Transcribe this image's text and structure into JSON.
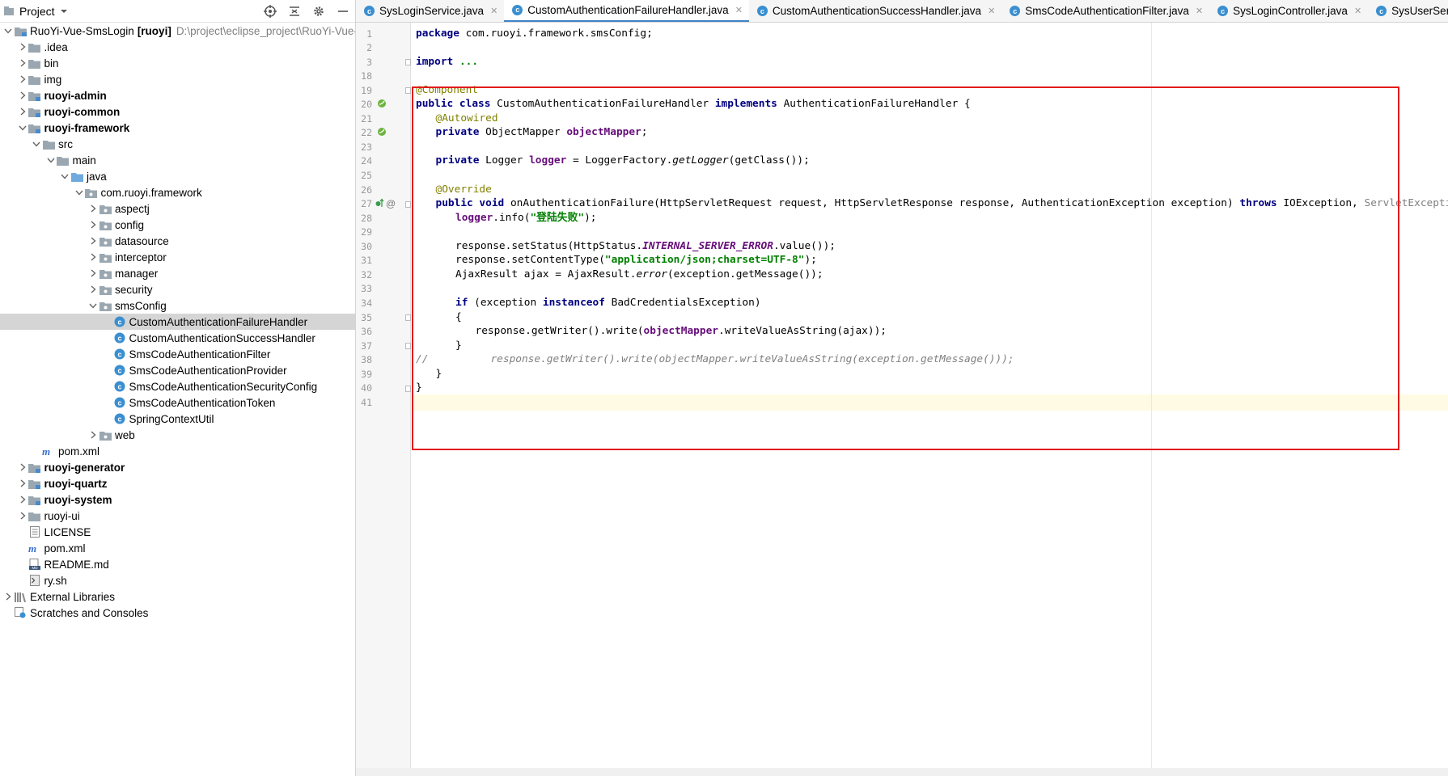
{
  "project_panel": {
    "title": "Project",
    "tree": [
      {
        "label": "RuoYi-Vue-SmsLogin",
        "suffix": "[ruoyi]",
        "path": "D:\\project\\eclipse_project\\RuoYi-Vue-Sm",
        "icon": "module-folder-icon",
        "expanded": true
      },
      {
        "label": ".idea",
        "icon": "folder-icon"
      },
      {
        "label": "bin",
        "icon": "folder-icon"
      },
      {
        "label": "img",
        "icon": "folder-icon"
      },
      {
        "label": "ruoyi-admin",
        "icon": "module-folder-icon"
      },
      {
        "label": "ruoyi-common",
        "icon": "module-folder-icon"
      },
      {
        "label": "ruoyi-framework",
        "icon": "module-folder-icon"
      },
      {
        "label": "src",
        "icon": "folder-icon"
      },
      {
        "label": "main",
        "icon": "folder-icon"
      },
      {
        "label": "java",
        "icon": "source-folder-icon"
      },
      {
        "label": "com.ruoyi.framework",
        "icon": "package-icon"
      },
      {
        "label": "aspectj",
        "icon": "package-icon"
      },
      {
        "label": "config",
        "icon": "package-icon"
      },
      {
        "label": "datasource",
        "icon": "package-icon"
      },
      {
        "label": "interceptor",
        "icon": "package-icon"
      },
      {
        "label": "manager",
        "icon": "package-icon"
      },
      {
        "label": "security",
        "icon": "package-icon"
      },
      {
        "label": "smsConfig",
        "icon": "package-icon"
      },
      {
        "label": "CustomAuthenticationFailureHandler",
        "icon": "java-class-icon"
      },
      {
        "label": "CustomAuthenticationSuccessHandler",
        "icon": "java-class-icon"
      },
      {
        "label": "SmsCodeAuthenticationFilter",
        "icon": "java-class-icon"
      },
      {
        "label": "SmsCodeAuthenticationProvider",
        "icon": "java-class-icon"
      },
      {
        "label": "SmsCodeAuthenticationSecurityConfig",
        "icon": "java-class-icon"
      },
      {
        "label": "SmsCodeAuthenticationToken",
        "icon": "java-class-icon"
      },
      {
        "label": "SpringContextUtil",
        "icon": "java-class-icon"
      },
      {
        "label": "web",
        "icon": "package-icon"
      },
      {
        "label": "pom.xml",
        "icon": "maven-icon"
      },
      {
        "label": "ruoyi-generator",
        "icon": "module-folder-icon"
      },
      {
        "label": "ruoyi-quartz",
        "icon": "module-folder-icon"
      },
      {
        "label": "ruoyi-system",
        "icon": "module-folder-icon"
      },
      {
        "label": "ruoyi-ui",
        "icon": "folder-icon"
      },
      {
        "label": "LICENSE",
        "icon": "text-file-icon"
      },
      {
        "label": "pom.xml",
        "icon": "maven-icon"
      },
      {
        "label": "README.md",
        "icon": "markdown-icon"
      },
      {
        "label": "ry.sh",
        "icon": "shell-icon"
      },
      {
        "label": "External Libraries",
        "icon": "libraries-icon"
      },
      {
        "label": "Scratches and Consoles",
        "icon": "scratches-icon"
      }
    ]
  },
  "tabs": [
    {
      "label": "SysLoginService.java"
    },
    {
      "label": "CustomAuthenticationFailureHandler.java",
      "active": true
    },
    {
      "label": "CustomAuthenticationSuccessHandler.java"
    },
    {
      "label": "SmsCodeAuthenticationFilter.java"
    },
    {
      "label": "SysLoginController.java"
    },
    {
      "label": "SysUserServiceImpl.java"
    }
  ],
  "editor": {
    "line_numbers": [
      "1",
      "2",
      "3",
      "18",
      "19",
      "20",
      "21",
      "22",
      "23",
      "24",
      "25",
      "26",
      "27",
      "28",
      "29",
      "30",
      "31",
      "32",
      "33",
      "34",
      "35",
      "36",
      "37",
      "38",
      "39",
      "40",
      "41"
    ],
    "code": {
      "l1_kw": "package",
      "l1_rest": " com.ruoyi.framework.smsConfig;",
      "l3_kw": "import",
      "l3_fold": "...",
      "l19_ann": "@Component",
      "l20_kw1": "public class",
      "l20_name": " CustomAuthenticationFailureHandler ",
      "l20_kw2": "implements",
      "l20_rest": " AuthenticationFailureHandler {",
      "l21_ann": "@Autowired",
      "l22_kw": "private",
      "l22_type": " ObjectMapper ",
      "l22_fld": "objectMapper",
      "l22_end": ";",
      "l24_kw": "private",
      "l24_type": " Logger ",
      "l24_fld": "logger",
      "l24_mid": " = LoggerFactory.",
      "l24_it": "getLogger",
      "l24_end": "(getClass());",
      "l26_ann": "@Override",
      "l27_kw": "public void",
      "l27_sig": " onAuthenticationFailure(HttpServletRequest request, HttpServletResponse response, AuthenticationException exception) ",
      "l27_kw2": "throws",
      "l27_ex": " IOException, ",
      "l27_dim": "ServletException",
      "l27_end": " {",
      "l28_fld": "logger",
      "l28_mid": ".info(",
      "l28_str": "\"登陆失败\"",
      "l28_end": ");",
      "l30_pre": "response.setStatus(HttpStatus.",
      "l30_sf": "INTERNAL_SERVER_ERROR",
      "l30_end": ".value());",
      "l31_pre": "response.setContentType(",
      "l31_str": "\"application/json;charset=UTF-8\"",
      "l31_end": ");",
      "l32_pre": "AjaxResult ajax = AjaxResult.",
      "l32_it": "error",
      "l32_end": "(exception.getMessage());",
      "l34_kw": "if",
      "l34_mid": " (exception ",
      "l34_kw2": "instanceof",
      "l34_end": " BadCredentialsException)",
      "l35": "{",
      "l36_pre": "response.getWriter().write(",
      "l36_fld": "objectMapper",
      "l36_end": ".writeValueAsString(ajax));",
      "l37": "}",
      "l38": "//          response.getWriter().write(objectMapper.writeValueAsString(exception.getMessage()));",
      "l39": "}",
      "l40": "}"
    }
  },
  "colors": {
    "highlight_border": "#e21b1b",
    "active_tab_underline": "#4083c9",
    "current_line": "#fffae3"
  }
}
